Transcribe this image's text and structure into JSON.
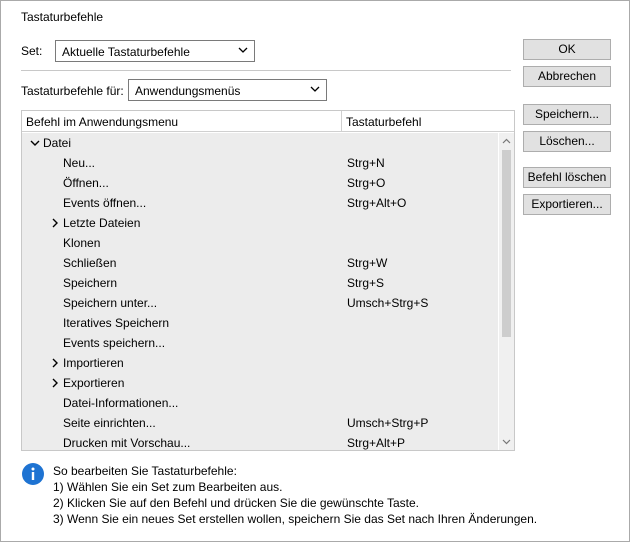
{
  "window": {
    "title": "Tastaturbefehle"
  },
  "set": {
    "label": "Set:",
    "value": "Aktuelle Tastaturbefehle"
  },
  "context": {
    "label": "Tastaturbefehle für:",
    "value": "Anwendungsmenüs"
  },
  "buttons": {
    "ok": "OK",
    "cancel": "Abbrechen",
    "save": "Speichern...",
    "delete": "Löschen...",
    "clear_command": "Befehl löschen",
    "export": "Exportieren..."
  },
  "grid": {
    "col_command": "Befehl im Anwendungsmenu",
    "col_shortcut": "Tastaturbefehl",
    "rows": [
      {
        "label": "Datei",
        "shortcut": "",
        "level": 0,
        "expander": "expanded"
      },
      {
        "label": "Neu...",
        "shortcut": "Strg+N",
        "level": 1,
        "expander": ""
      },
      {
        "label": "Öffnen...",
        "shortcut": "Strg+O",
        "level": 1,
        "expander": ""
      },
      {
        "label": "Events öffnen...",
        "shortcut": "Strg+Alt+O",
        "level": 1,
        "expander": ""
      },
      {
        "label": "Letzte Dateien",
        "shortcut": "",
        "level": 1,
        "expander": "collapsed"
      },
      {
        "label": "Klonen",
        "shortcut": "",
        "level": 1,
        "expander": ""
      },
      {
        "label": "Schließen",
        "shortcut": "Strg+W",
        "level": 1,
        "expander": ""
      },
      {
        "label": "Speichern",
        "shortcut": "Strg+S",
        "level": 1,
        "expander": ""
      },
      {
        "label": "Speichern unter...",
        "shortcut": "Umsch+Strg+S",
        "level": 1,
        "expander": ""
      },
      {
        "label": "Iteratives Speichern",
        "shortcut": "",
        "level": 1,
        "expander": ""
      },
      {
        "label": "Events speichern...",
        "shortcut": "",
        "level": 1,
        "expander": ""
      },
      {
        "label": "Importieren",
        "shortcut": "",
        "level": 1,
        "expander": "collapsed"
      },
      {
        "label": "Exportieren",
        "shortcut": "",
        "level": 1,
        "expander": "collapsed"
      },
      {
        "label": "Datei-Informationen...",
        "shortcut": "",
        "level": 1,
        "expander": ""
      },
      {
        "label": "Seite einrichten...",
        "shortcut": "Umsch+Strg+P",
        "level": 1,
        "expander": ""
      },
      {
        "label": "Drucken mit Vorschau...",
        "shortcut": "Strg+Alt+P",
        "level": 1,
        "expander": ""
      }
    ]
  },
  "info": {
    "icon": "info-icon",
    "lines": [
      "So bearbeiten Sie Tastaturbefehle:",
      "1) Wählen Sie ein Set zum Bearbeiten aus.",
      "2) Klicken Sie auf den Befehl und drücken Sie die gewünschte Taste.",
      "3) Wenn Sie ein neues Set erstellen wollen, speichern Sie das Set nach Ihren Änderungen."
    ]
  },
  "colors": {
    "info_blue": "#1e73d2",
    "list_bg": "#ececec",
    "button_bg": "#e1e1e1"
  }
}
